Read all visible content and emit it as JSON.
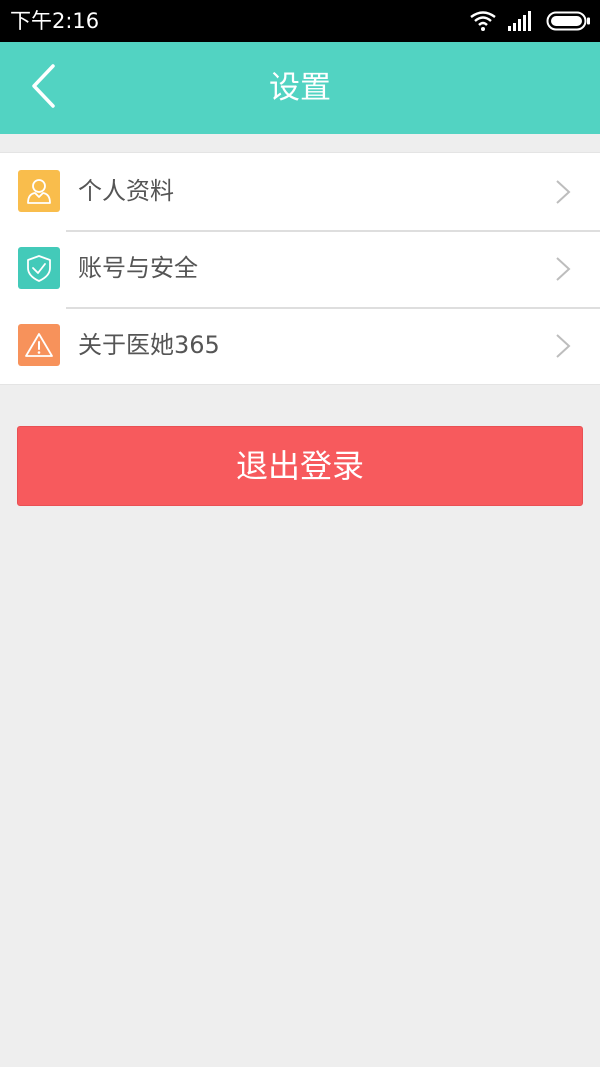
{
  "status_bar": {
    "time": "下午2:16",
    "icons": [
      "wifi-icon",
      "signal-icon",
      "battery-icon"
    ]
  },
  "header": {
    "title": "设置",
    "back_icon": "back-arrow-icon",
    "background": "#52d3c2"
  },
  "settings": {
    "items": [
      {
        "label": "个人资料",
        "icon": "user-profile-icon",
        "icon_color": "#f9bd4c"
      },
      {
        "label": "账号与安全",
        "icon": "shield-check-icon",
        "icon_color": "#43cab9"
      },
      {
        "label": "关于医她365",
        "icon": "warning-triangle-icon",
        "icon_color": "#f7925b"
      }
    ]
  },
  "logout": {
    "label": "退出登录",
    "color": "#f75a5d"
  }
}
